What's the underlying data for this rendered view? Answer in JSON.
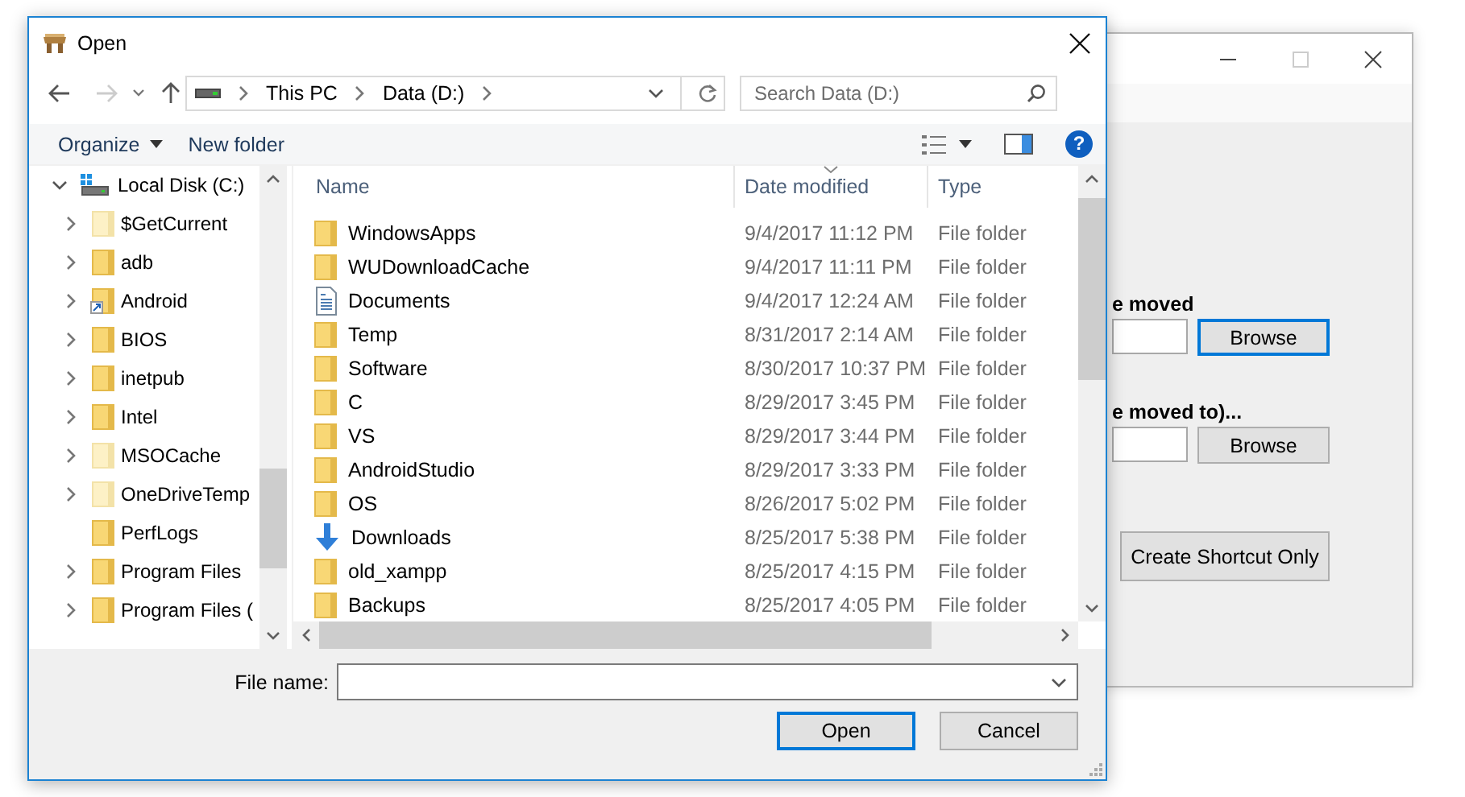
{
  "background_window": {
    "source": {
      "label": "e moved",
      "button": {
        "label": "Browse",
        "focused": true
      }
    },
    "destination": {
      "label": "e moved to)...",
      "button": {
        "label": "Browse",
        "focused": false
      }
    },
    "shortcut_button": "Create Shortcut Only"
  },
  "dialog": {
    "title": "Open",
    "address": {
      "path": [
        "This PC",
        "Data (D:)"
      ],
      "search_placeholder": "Search Data (D:)"
    },
    "toolbar": {
      "organize": "Organize",
      "new_folder": "New folder",
      "help": "?"
    },
    "tree": {
      "label": "Local Disk (C:)",
      "expanded": true,
      "children": [
        {
          "label": "$GetCurrent",
          "expandable": true,
          "hidden": true,
          "kind": "folder"
        },
        {
          "label": "adb",
          "expandable": true,
          "hidden": false,
          "kind": "folder"
        },
        {
          "label": "Android",
          "expandable": true,
          "hidden": false,
          "kind": "shortcut"
        },
        {
          "label": "BIOS",
          "expandable": true,
          "hidden": false,
          "kind": "folder"
        },
        {
          "label": "inetpub",
          "expandable": true,
          "hidden": false,
          "kind": "folder"
        },
        {
          "label": "Intel",
          "expandable": true,
          "hidden": false,
          "kind": "folder"
        },
        {
          "label": "MSOCache",
          "expandable": true,
          "hidden": true,
          "kind": "folder"
        },
        {
          "label": "OneDriveTemp",
          "expandable": true,
          "hidden": true,
          "kind": "folder"
        },
        {
          "label": "PerfLogs",
          "expandable": false,
          "hidden": false,
          "kind": "folder"
        },
        {
          "label": "Program Files",
          "expandable": true,
          "hidden": false,
          "kind": "folder"
        },
        {
          "label": "Program Files (",
          "expandable": true,
          "hidden": false,
          "kind": "folder"
        }
      ]
    },
    "columns": [
      {
        "label": "Name",
        "sorted": false
      },
      {
        "label": "Date modified",
        "sorted": true
      },
      {
        "label": "Type",
        "sorted": false
      }
    ],
    "files": [
      {
        "name": "WindowsApps",
        "kind": "folder",
        "date": "9/4/2017 11:12 PM",
        "type": "File folder"
      },
      {
        "name": "WUDownloadCache",
        "kind": "folder",
        "date": "9/4/2017 11:11 PM",
        "type": "File folder"
      },
      {
        "name": "Documents",
        "kind": "documents",
        "date": "9/4/2017 12:24 AM",
        "type": "File folder"
      },
      {
        "name": "Temp",
        "kind": "folder",
        "date": "8/31/2017 2:14 AM",
        "type": "File folder"
      },
      {
        "name": "Software",
        "kind": "folder",
        "date": "8/30/2017 10:37 PM",
        "type": "File folder"
      },
      {
        "name": "C",
        "kind": "folder",
        "date": "8/29/2017 3:45 PM",
        "type": "File folder"
      },
      {
        "name": "VS",
        "kind": "folder",
        "date": "8/29/2017 3:44 PM",
        "type": "File folder"
      },
      {
        "name": "AndroidStudio",
        "kind": "folder",
        "date": "8/29/2017 3:33 PM",
        "type": "File folder"
      },
      {
        "name": "OS",
        "kind": "folder",
        "date": "8/26/2017 5:02 PM",
        "type": "File folder"
      },
      {
        "name": "Downloads",
        "kind": "downloads",
        "date": "8/25/2017 5:38 PM",
        "type": "File folder"
      },
      {
        "name": "old_xampp",
        "kind": "folder",
        "date": "8/25/2017 4:15 PM",
        "type": "File folder"
      },
      {
        "name": "Backups",
        "kind": "folder",
        "date": "8/25/2017 4:05 PM",
        "type": "File folder"
      }
    ],
    "file_name": {
      "label": "File name:"
    },
    "buttons": [
      {
        "label": "Open",
        "default": true
      },
      {
        "label": "Cancel",
        "default": false
      }
    ]
  }
}
